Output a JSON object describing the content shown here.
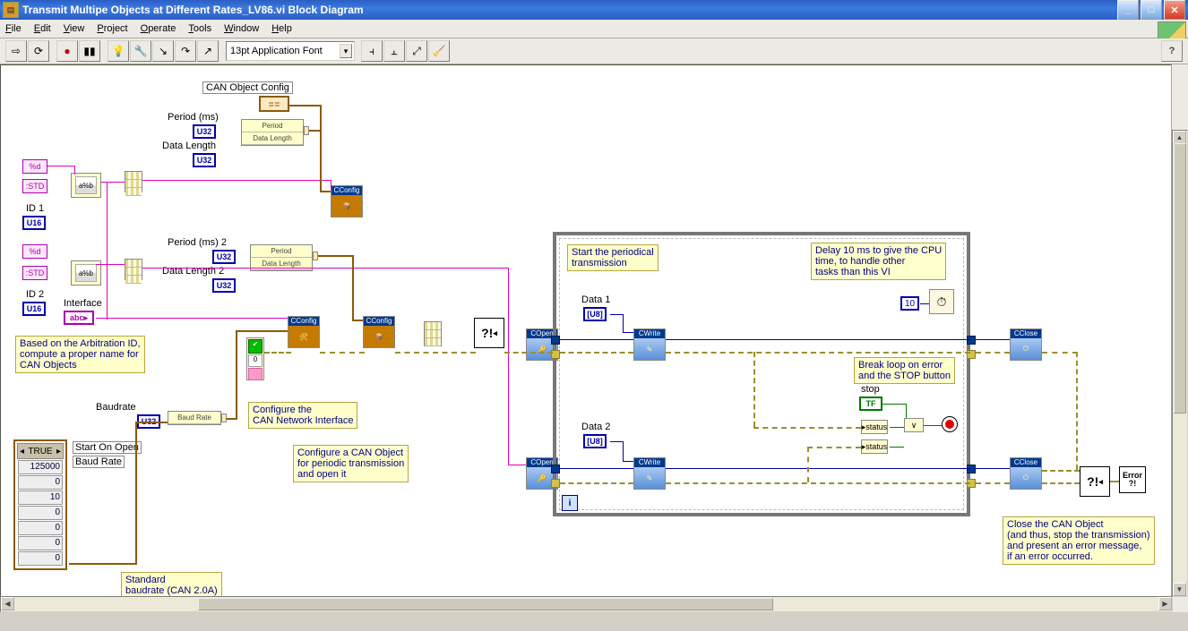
{
  "window": {
    "title": "Transmit Multipe Objects at Different Rates_LV86.vi Block Diagram",
    "menu": {
      "file": "File",
      "edit": "Edit",
      "view": "View",
      "project": "Project",
      "operate": "Operate",
      "tools": "Tools",
      "window": "Window",
      "help": "Help"
    },
    "toolbar": {
      "run": "▷",
      "run_cont": "⟳",
      "abort": "●",
      "pause": "▮▮",
      "bulb": "💡",
      "retain": "🔧",
      "step_into": "↘",
      "step_over": "↷",
      "step_out": "↗",
      "font": "13pt Application Font",
      "align": "⫞",
      "distribute": "⫠",
      "reorder": "⤢",
      "cleanup": "🧹",
      "help": "?",
      "diagram_icon": "VI"
    },
    "winbuttons": {
      "min": "_",
      "max": "□",
      "close": "✕"
    }
  },
  "terminals": {
    "fmt1": "%d",
    "std1": ":STD",
    "id1": "ID 1",
    "id1_type": "U16",
    "fmt2": "%d",
    "std2": ":STD",
    "id2": "ID 2",
    "id2_type": "U16",
    "interface": "Interface",
    "interface_type": "abc",
    "baudrate": "Baudrate",
    "baudrate_type": "U32",
    "period": "Period (ms)",
    "period_type": "U32",
    "datalength": "Data Length",
    "datalength_type": "U32",
    "period2": "Period (ms) 2",
    "period2_type": "U32",
    "datalength2": "Data Length 2",
    "datalength2_type": "U32",
    "data1": "Data 1",
    "data1_type": "U8",
    "data2": "Data 2",
    "data2_type": "U8",
    "stop": "stop",
    "stop_type": "TF",
    "status1": "status",
    "status2": "status",
    "wait_const": "10"
  },
  "bundles": {
    "bnd1": {
      "r1": "Period",
      "r2": "Data Length"
    },
    "bnd2": {
      "r1": "Period",
      "r2": "Data Length"
    },
    "br": {
      "r1": "Baud Rate"
    }
  },
  "cluster": {
    "header": "TRUE",
    "right": "▾",
    "labels": {
      "a": "Start On Open",
      "b": "Baud Rate"
    },
    "vals": [
      "125000",
      "0",
      "10",
      "0",
      "0",
      "0",
      "0"
    ]
  },
  "funcs": {
    "cconfig": "CConfig",
    "copen": "COpen",
    "cwrite": "CWrite",
    "cclose": "CClose",
    "can_iface": "Can Iface",
    "canobj": "Can Obj",
    "merr": "?!",
    "errout": "Error ?!"
  },
  "canobj_const": "CAN Object Config",
  "comments": {
    "arb": "Based on the Arbitration ID,\ncompute a proper name for\nCAN Objects",
    "cfgnet": "Configure the\nCAN Network Interface",
    "cfgobj": "Configure a CAN Object\nfor periodic transmission\nand open it",
    "start": "Start the periodical\ntransmission",
    "delay": "Delay 10 ms to give the CPU\ntime, to handle other\ntasks than this VI",
    "break": "Break loop on error\nand the STOP button",
    "close": "Close the CAN Object\n(and thus, stop the transmission)\nand present an error message,\nif an error occurred.",
    "stdbaud": "Standard\nbaudrate (CAN 2.0A)"
  },
  "or_gate": "∨"
}
